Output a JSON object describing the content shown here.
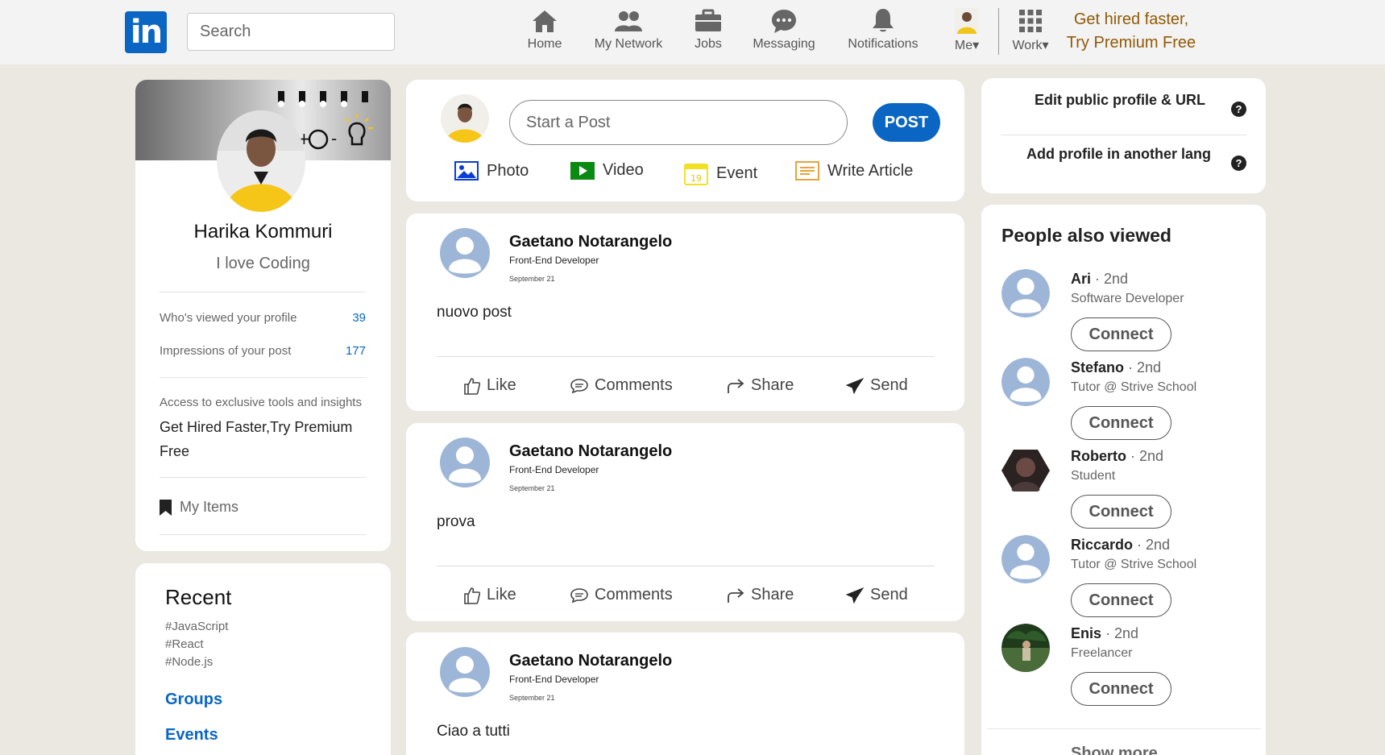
{
  "nav": {
    "logo": "in",
    "search_placeholder": "Search",
    "items": [
      {
        "label": "Home",
        "icon": "home-icon"
      },
      {
        "label": "My Network",
        "icon": "network-icon"
      },
      {
        "label": "Jobs",
        "icon": "briefcase-icon"
      },
      {
        "label": "Messaging",
        "icon": "messaging-icon"
      },
      {
        "label": "Notifications",
        "icon": "bell-icon"
      },
      {
        "label": "Me",
        "icon": "avatar"
      },
      {
        "label": "Work",
        "icon": "grid-icon"
      }
    ],
    "premium_line1": "Get hired faster,",
    "premium_line2": "Try Premium Free"
  },
  "profile": {
    "name": "Harika Kommuri",
    "tagline": "I love Coding",
    "stats": [
      {
        "label": "Who's viewed your profile",
        "value": "39"
      },
      {
        "label": "Impressions of your post",
        "value": "177"
      }
    ],
    "access_text": "Access to exclusive tools and insights",
    "premium_text": "Get Hired Faster,Try Premium Free",
    "my_items": "My Items"
  },
  "recent": {
    "title": "Recent",
    "tags": [
      "#JavaScript",
      "#React",
      "#Node.js"
    ],
    "groups": "Groups",
    "events": "Events"
  },
  "composer": {
    "placeholder": "Start a Post",
    "post_button": "POST",
    "actions": [
      {
        "label": "Photo",
        "icon": "photo-icon",
        "color": "#0a3dd6"
      },
      {
        "label": "Video",
        "icon": "video-icon",
        "color": "#0b8a12"
      },
      {
        "label": "Event",
        "icon": "calendar-icon",
        "color": "#f2e024"
      },
      {
        "label": "Write Article",
        "icon": "article-icon",
        "color": "#e8a33b"
      }
    ]
  },
  "posts": [
    {
      "author": "Gaetano Notarangelo",
      "role": "Front-End Developer",
      "date": "September 21",
      "text": "nuovo post"
    },
    {
      "author": "Gaetano Notarangelo",
      "role": "Front-End Developer",
      "date": "September 21",
      "text": "prova"
    },
    {
      "author": "Gaetano Notarangelo",
      "role": "Front-End Developer",
      "date": "September 21",
      "text": "Ciao a tutti"
    }
  ],
  "post_actions": {
    "like": "Like",
    "comments": "Comments",
    "share": "Share",
    "send": "Send"
  },
  "right": {
    "edit_profile": "Edit public profile & URL",
    "add_lang": "Add profile in another lang",
    "help": "?",
    "people_title": "People also viewed",
    "people": [
      {
        "name": "Ari",
        "degree": "2nd",
        "role": "Software Developer",
        "avatar": "default"
      },
      {
        "name": "Stefano",
        "degree": "2nd",
        "role": "Tutor @ Strive School",
        "avatar": "default"
      },
      {
        "name": "Roberto",
        "degree": "2nd",
        "role": "Student",
        "avatar": "photo-dark"
      },
      {
        "name": "Riccardo",
        "degree": "2nd",
        "role": "Tutor @ Strive School",
        "avatar": "default"
      },
      {
        "name": "Enis",
        "degree": "2nd",
        "role": "Freelancer",
        "avatar": "photo-nature"
      }
    ],
    "connect": "Connect",
    "show_more": "Show more"
  },
  "colors": {
    "brand": "#0a66c2",
    "premium": "#915907",
    "background": "#ebe8e2"
  }
}
